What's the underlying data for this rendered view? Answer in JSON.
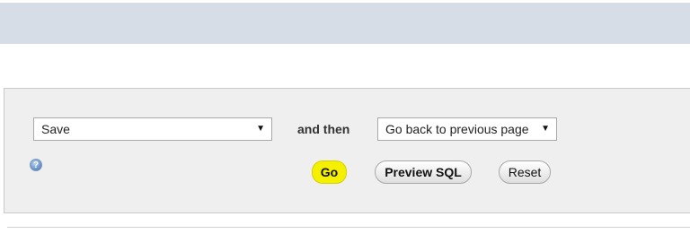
{
  "form": {
    "action_select": {
      "value": "Save"
    },
    "and_then_label": "and then",
    "after_select": {
      "value": "Go back to previous page"
    },
    "buttons": {
      "go": "Go",
      "preview_sql": "Preview SQL",
      "reset": "Reset"
    },
    "help_icon": "?"
  },
  "colors": {
    "top_band": "#d6dde6",
    "panel_bg": "#efefef",
    "go_highlight": "#f5f000",
    "help_icon": "#5d88c0"
  },
  "icons": {
    "help": "help-icon",
    "dropdown": "chevron-down-icon"
  }
}
